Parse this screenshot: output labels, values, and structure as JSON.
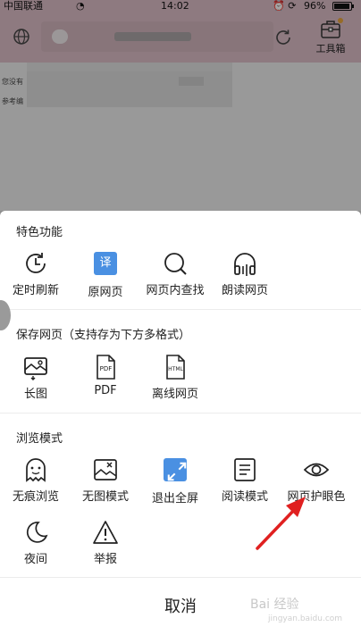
{
  "status_bar": {
    "carrier": "中国联通",
    "time": "14:02",
    "battery": "96%",
    "battery_level": 0.96
  },
  "browser": {
    "toolbox_label": "工具箱",
    "page_text_1": "您没有",
    "page_text_2": "参考编"
  },
  "sections": {
    "special": {
      "title": "特色功能",
      "items": [
        {
          "label": "定时刷新",
          "icon": "clock-icon"
        },
        {
          "label": "原网页",
          "icon": "translate-icon",
          "badge": "译"
        },
        {
          "label": "网页内查找",
          "icon": "search-icon"
        },
        {
          "label": "朗读网页",
          "icon": "headphones-icon"
        }
      ]
    },
    "save": {
      "title": "保存网页（支持存为下方多格式）",
      "items": [
        {
          "label": "长图",
          "icon": "long-image-icon"
        },
        {
          "label": "PDF",
          "icon": "pdf-file-icon",
          "badge": "PDF"
        },
        {
          "label": "离线网页",
          "icon": "html-file-icon",
          "badge": "HTML"
        }
      ]
    },
    "browse": {
      "title": "浏览模式",
      "items": [
        {
          "label": "无痕浏览",
          "icon": "ghost-icon"
        },
        {
          "label": "无图模式",
          "icon": "no-image-icon"
        },
        {
          "label": "退出全屏",
          "icon": "exit-fullscreen-icon"
        },
        {
          "label": "阅读模式",
          "icon": "reader-icon"
        },
        {
          "label": "网页护眼色",
          "icon": "eye-icon"
        },
        {
          "label": "夜间",
          "icon": "moon-icon"
        },
        {
          "label": "举报",
          "icon": "warning-icon"
        }
      ]
    }
  },
  "cancel_label": "取消",
  "watermark": "Bai 经验",
  "watermark_sub": "jingyan.baidu.com",
  "colors": {
    "accent": "#4a90e2",
    "arrow": "#e02020",
    "nav_bg": "#d8b9c2"
  }
}
